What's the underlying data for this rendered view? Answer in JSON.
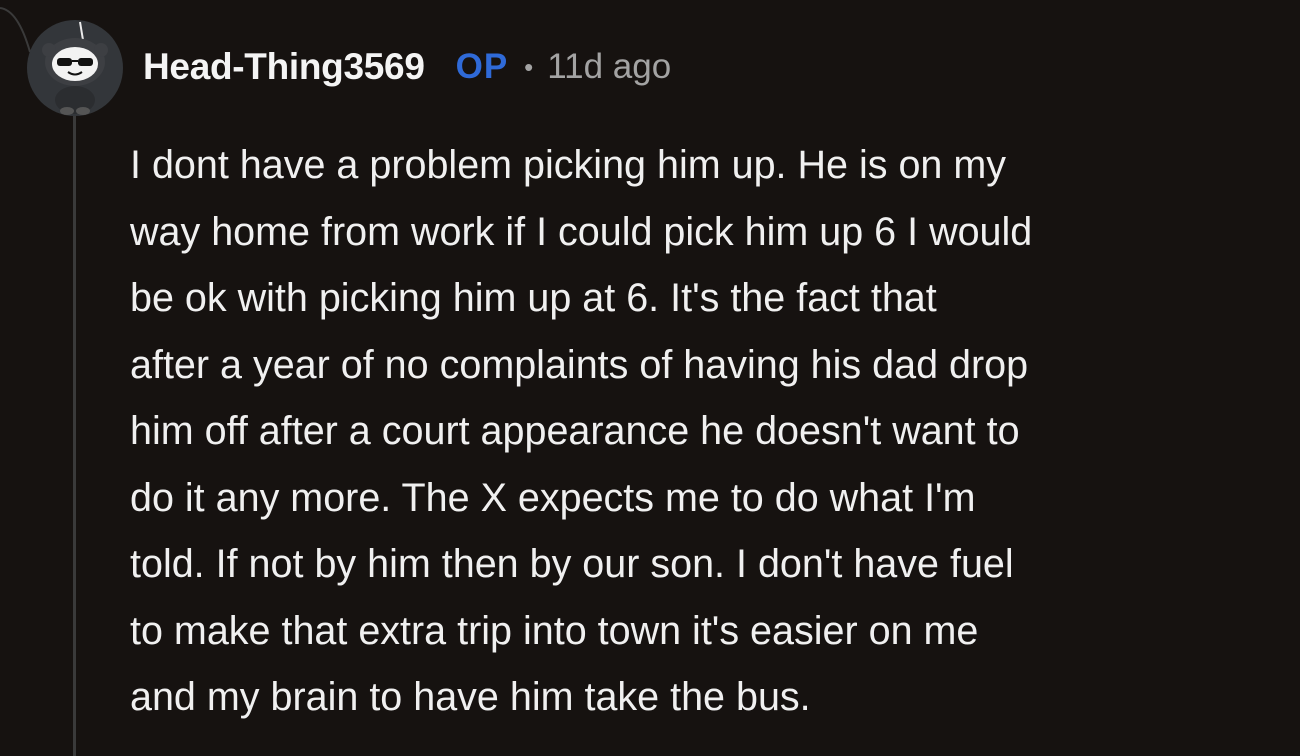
{
  "comment": {
    "author": "Head-Thing3569",
    "badge": "OP",
    "separator": "•",
    "timestamp": "11d ago",
    "body": "I dont have a problem picking him up. He is on my\nway home from work if I could pick him up 6 I would\nbe ok with picking him up at 6. It's the fact that\nafter a year of no complaints of having his dad drop\nhim off after a court appearance he doesn't want to\ndo it any more. The X expects me to do what I'm\ntold. If not by him then by our son. I don't have fuel\nto make that extra trip into town it's easier on me\nand my brain to have him take the bus."
  },
  "colors": {
    "background": "#161210",
    "op_badge": "#2f6ad8",
    "meta_text": "#a3a3a3",
    "thread_line": "#3a3a3a"
  },
  "icons": {
    "avatar": "snoo-avatar-with-sunglasses"
  }
}
